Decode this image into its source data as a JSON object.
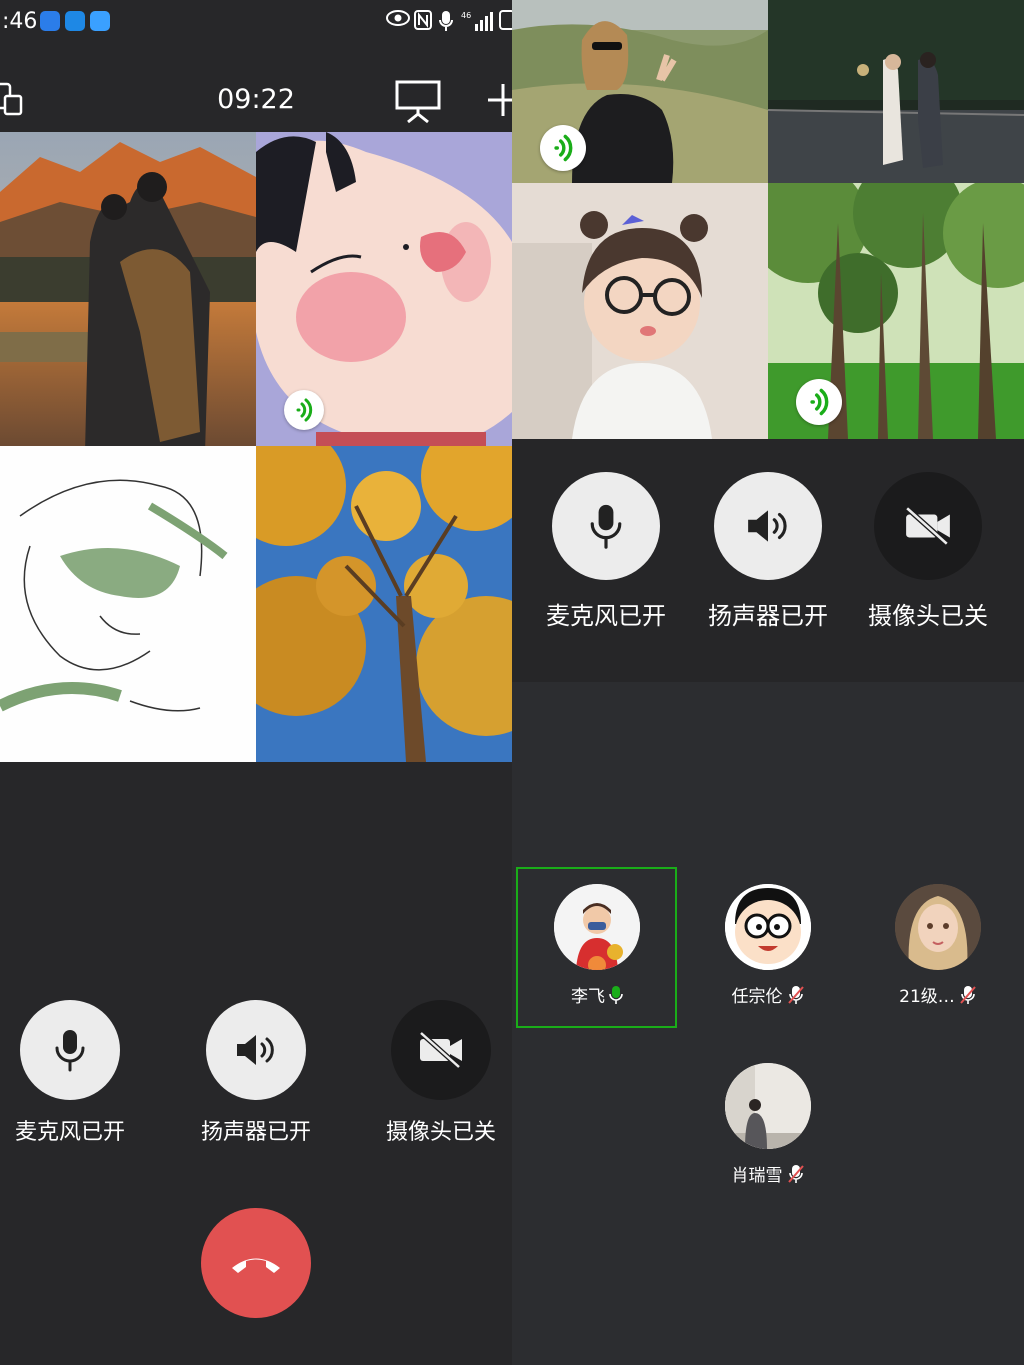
{
  "status_bar": {
    "time": ":46",
    "network": "46"
  },
  "call": {
    "duration": "09:22"
  },
  "controls": {
    "mic_label": "麦克风已开",
    "speaker_label": "扬声器已开",
    "camera_label": "摄像头已关"
  },
  "members": [
    {
      "name": "李飞",
      "mic": "on",
      "selected": true
    },
    {
      "name": "任宗伦",
      "mic": "off"
    },
    {
      "name": "21级…",
      "mic": "off"
    },
    {
      "name": "肖瑞雪",
      "mic": "off"
    }
  ],
  "colors": {
    "hangup": "#e15151",
    "voice_active": "#1aad19",
    "selected_border": "#1aad19"
  },
  "icons": [
    "mic-icon",
    "speaker-icon",
    "camera-off-icon",
    "hangup-icon",
    "screen-share-icon",
    "add-member-icon",
    "minimize-icon",
    "voice-activity-icon",
    "mic-muted-icon"
  ]
}
